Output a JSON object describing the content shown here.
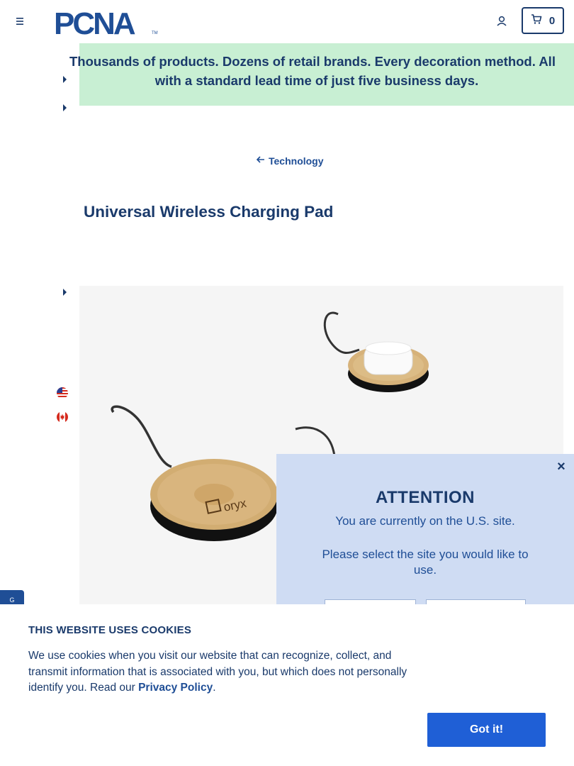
{
  "header": {
    "menu_icon": "hamburger-menu-icon",
    "logo_text": "PCNA",
    "logo_tm": "TM",
    "account_icon": "user-icon",
    "cart_icon": "cart-icon",
    "cart_count": "0"
  },
  "banner": {
    "line1": "Thousands of products. Dozens of retail brands. Every decoration method. All",
    "line2": "with a standard lead time of just five business days."
  },
  "breadcrumb": {
    "icon": "arrow-left-icon",
    "label": "Technology"
  },
  "product": {
    "title": "Universal Wireless Charging Pad",
    "engraving": "oryx"
  },
  "flags": {
    "us": "us-flag-icon",
    "ca": "canada-flag-icon"
  },
  "side_tab": {
    "label": "G"
  },
  "modal": {
    "close": "×",
    "title": "ATTENTION",
    "text": "You are currently on the U.S. site.",
    "text2": "Please select the site you would like to use."
  },
  "cookie": {
    "title": "THIS WEBSITE USES COOKIES",
    "text": "We use cookies when you visit our website that can recognize, collect, and transmit information that is associated with you, but which does not personally identify you. Read our ",
    "link": "Privacy Policy",
    "period": ".",
    "button": "Got it!"
  },
  "colors": {
    "brand_navy": "#1a3a6b",
    "brand_blue": "#1f4e96",
    "banner_green": "#c8efd3",
    "modal_bg": "#cfdcf3",
    "button_blue": "#1f5fd6"
  }
}
